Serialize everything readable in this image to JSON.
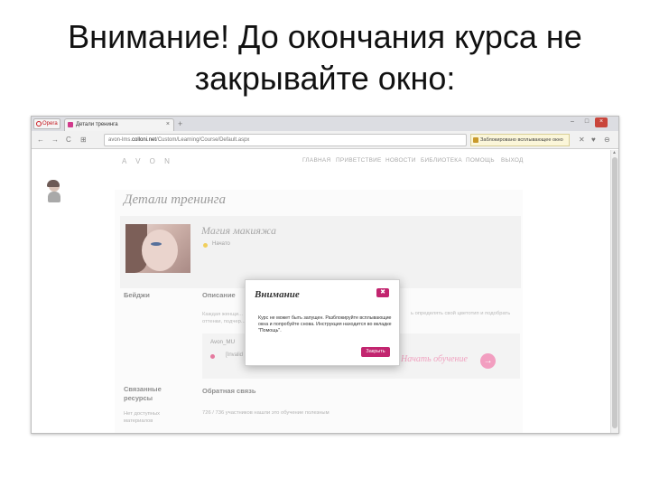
{
  "slide": {
    "title": "Внимание! До окончания курса не закрывайте окно:"
  },
  "browser": {
    "opera_label": "Opera",
    "tab_label": "Детали тренинга",
    "tab_close": "×",
    "new_tab": "+",
    "window_controls": [
      "–",
      "□",
      "×"
    ],
    "nav_buttons": [
      "←",
      "→",
      "C",
      "⊞"
    ],
    "url_prefix": "avon-lms.",
    "url_domain": "colloni.net",
    "url_path": "/Custom/Learning/Course/Default.aspx",
    "popup_blocked_text": "Заблокировано всплывающее окно",
    "nav_icons": [
      "✕",
      "♥",
      "⊖"
    ]
  },
  "site": {
    "logo": "A V O N",
    "nav": [
      "ГЛАВНАЯ",
      "ПРИВЕТСТВИЕ",
      "НОВОСТИ",
      "БИБЛИОТЕКА",
      "ПОМОЩЬ",
      "ВЫХОД"
    ],
    "page_title": "Детали тренинга",
    "course_title": "Магия макияжа",
    "course_status": "Начато",
    "badges_heading": "Бейджи",
    "description_heading": "Описание",
    "description_text": "Каждая женщи...",
    "description_text_line2": "оттенки, подчер...",
    "description_right": "ь определять свой цветотип и подобрать",
    "resource_name": "Avon_MU",
    "resource_status": "[Invalid Resource, notattempted]",
    "start_label": "Начать обучение",
    "start_arrow": "→",
    "related_heading": "Связанные ресурсы",
    "related_text": "Нет доступных материалов",
    "feedback_heading": "Обратная связь",
    "feedback_text": "726 / 736 участников нашли это обучение полезным"
  },
  "modal": {
    "title": "Внимание",
    "close": "✖",
    "message": "Курс не может быть запущен. Разблокируйте всплывающие окна и попробуйте снова. Инструкция находится во вкладке \"Помощь\".",
    "button": "Закрыть"
  },
  "colors": {
    "accent": "#c2256f",
    "link_pink": "#f0a3c0",
    "status_yellow": "#f1cf5c"
  }
}
